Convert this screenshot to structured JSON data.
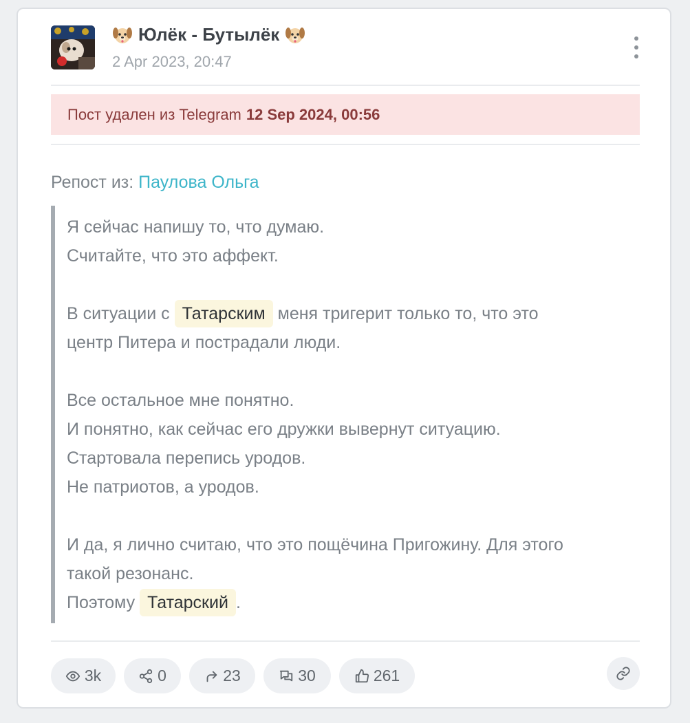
{
  "post": {
    "author": "Юлёк - Бутылёк",
    "date": "2 Apr 2023, 20:47",
    "deleted_prefix": "Пост удален из Telegram",
    "deleted_date": "12 Sep 2024, 00:56",
    "repost_label": "Репост из:",
    "repost_source": "Паулова Ольга",
    "body": {
      "l1": "Я сейчас напишу то, что думаю.",
      "l2": "Считайте, что это аффект.",
      "l3_pre": "В ситуации с",
      "tag1": "Татарским",
      "l3_post": "меня тригерит только то, что это",
      "l4": "центр Питера и пострадали люди.",
      "l5": "Все остальное мне понятно.",
      "l6": "И понятно, как сейчас его дружки вывернут ситуацию.",
      "l7": "Стартовала перепись уродов.",
      "l8": "Не патриотов, а уродов.",
      "l9": "И да, я лично считаю, что это пощёчина Пригожину. Для этого",
      "l10": "такой резонанс.",
      "l11_pre": "Поэтому",
      "tag2": "Татарский",
      "l11_post": "."
    }
  },
  "stats": {
    "views": "3k",
    "shares": "0",
    "forwards": "23",
    "comments": "30",
    "likes": "261"
  },
  "icons": {
    "author_emoji": "dog-face-icon",
    "menu": "more-vertical-icon",
    "views": "eye-icon",
    "shares": "share-nodes-icon",
    "forwards": "forward-arrow-icon",
    "comments": "comments-icon",
    "likes": "thumbs-up-icon",
    "link": "link-icon"
  },
  "colors": {
    "deleted_bg": "#fbe3e3",
    "deleted_text": "#8a3b3b",
    "link": "#3db5c9",
    "tag_bg": "#fbf6de",
    "quote_bar": "#a5abb1"
  }
}
